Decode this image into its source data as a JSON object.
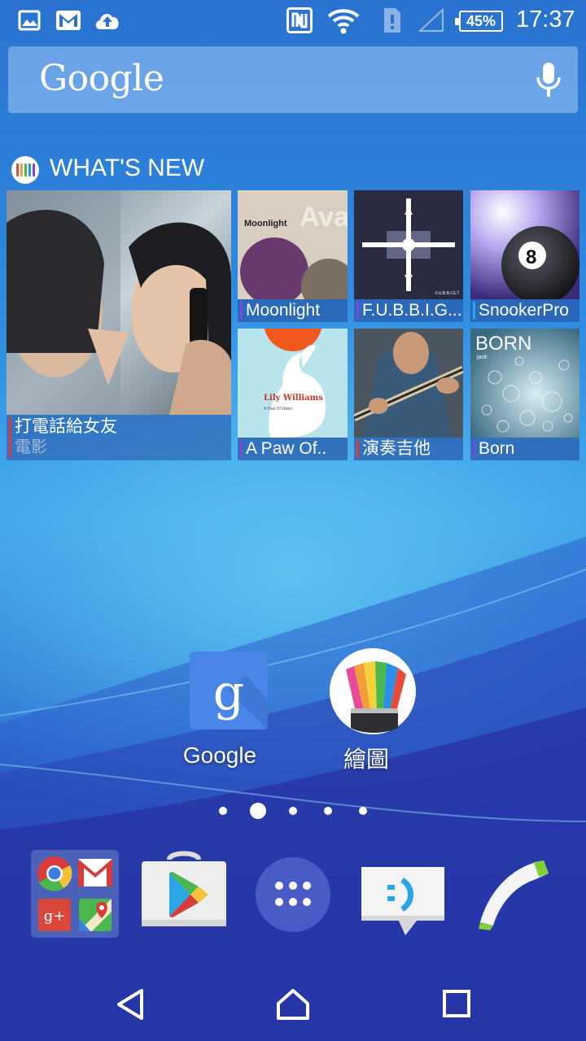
{
  "status_bar": {
    "time": "17:37",
    "battery_percent": "45%",
    "icons": [
      "gallery-icon",
      "gmail-icon",
      "cloud-upload-icon",
      "nfc-icon",
      "wifi-icon",
      "sim-icon",
      "signal-icon",
      "battery-icon"
    ]
  },
  "search": {
    "logo": "Google",
    "voice_icon": "mic-icon"
  },
  "whats_new": {
    "title": "WHAT'S NEW",
    "featured": {
      "title": "打電話給女友",
      "subtitle": "電影"
    },
    "tiles": [
      {
        "label": "Moonlight",
        "art_text": "Moonlight",
        "art_text2": "Ava"
      },
      {
        "label": "F.U.B.B.I.G...",
        "art_text": "F.U.B.B.I.G.T"
      },
      {
        "label": "SnookerPro",
        "art_text": "8"
      },
      {
        "label": "A Paw Of..",
        "art_text": "Lily Williams",
        "art_text2": "A Paw Of Water"
      },
      {
        "label": "演奏吉他"
      },
      {
        "label": "Born",
        "art_text": "BORN",
        "art_text2": "jack"
      }
    ]
  },
  "home_apps": [
    {
      "label": "Google",
      "icon": "google-app-icon"
    },
    {
      "label": "繪圖",
      "icon": "sketch-app-icon"
    }
  ],
  "page_indicator": {
    "count": 5,
    "active_index": 1
  },
  "dock": [
    {
      "name": "google-apps-folder",
      "icon": "folder-icon"
    },
    {
      "name": "play-store",
      "icon": "play-store-icon"
    },
    {
      "name": "app-drawer",
      "icon": "app-drawer-icon"
    },
    {
      "name": "messaging",
      "icon": "messaging-icon"
    },
    {
      "name": "phone",
      "icon": "phone-icon"
    }
  ],
  "nav_bar": {
    "back": "back-icon",
    "home": "home-icon",
    "recents": "recents-icon"
  },
  "colors": {
    "accent_purple": "#7b4bd6",
    "accent_red": "#d93a3a",
    "accent_blue": "#2aa6e6"
  }
}
